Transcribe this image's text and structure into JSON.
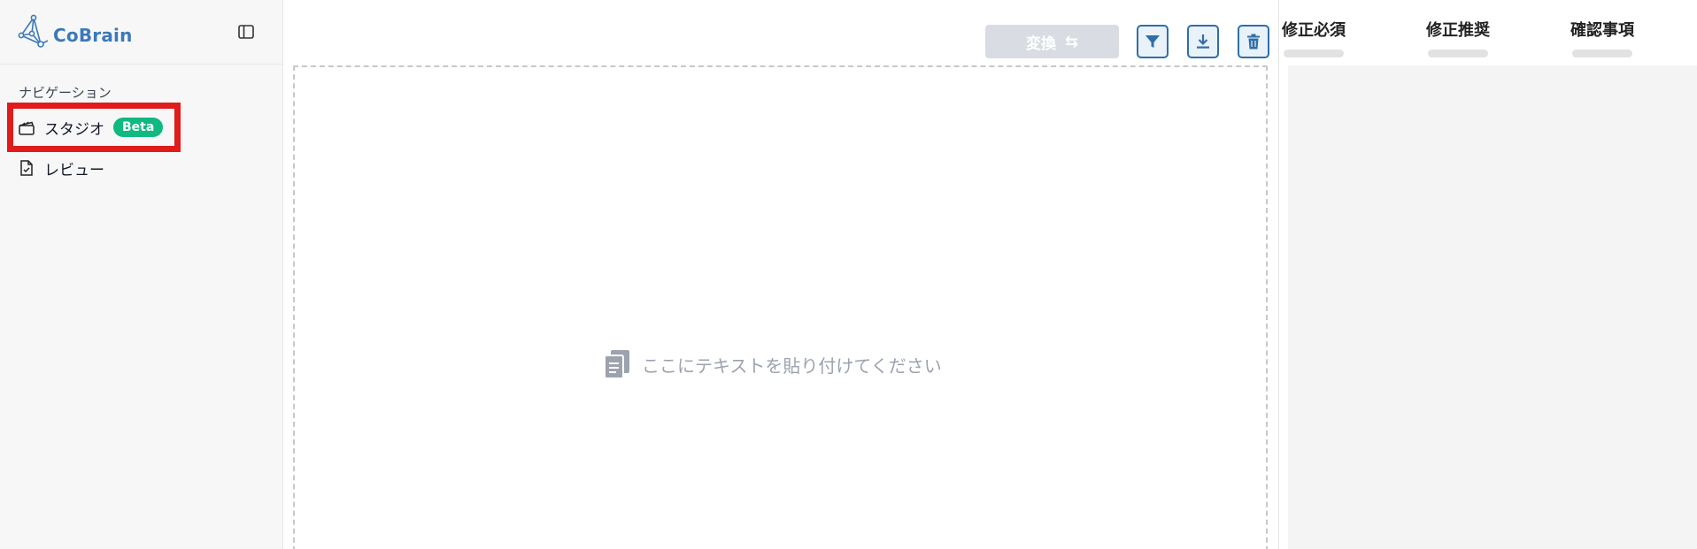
{
  "brand": {
    "name": "CoBrain",
    "color": "#3a7ab8"
  },
  "sidebar": {
    "section_label": "ナビゲーション",
    "items": [
      {
        "label": "スタジオ",
        "icon": "clapperboard-icon",
        "badge": "Beta"
      },
      {
        "label": "レビュー",
        "icon": "file-check-icon"
      }
    ]
  },
  "toolbar": {
    "convert_label": "変換",
    "convert_icon": "swap-arrows-icon",
    "filter_icon": "filter-icon",
    "download_icon": "download-icon",
    "delete_icon": "trash-icon"
  },
  "editor": {
    "placeholder": "ここにテキストを貼り付けてください",
    "icon": "paste-icon"
  },
  "results": {
    "tabs": [
      {
        "label": "修正必須"
      },
      {
        "label": "修正推奨"
      },
      {
        "label": "確認事項"
      }
    ]
  },
  "colors": {
    "accent": "#2f6fa8",
    "badge": "#10b981",
    "highlight": "#e01b1b",
    "disabled_button": "#d9dde3"
  }
}
